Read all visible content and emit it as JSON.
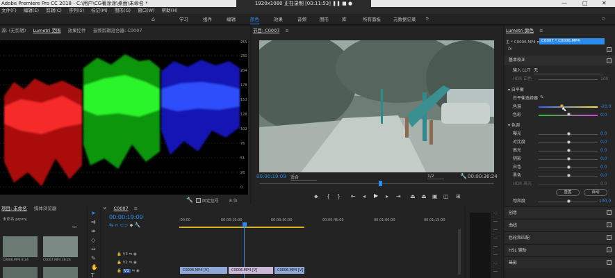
{
  "window": {
    "title": "Adobe Premiere Pro CC 2018 - C:\\用户\\CG著涂涂\\桌面\\未命名 *",
    "minimize": "—",
    "maximize": "□",
    "close": "✕"
  },
  "recorder": {
    "text": "1920x1080 正在录制 [00:11:53]"
  },
  "menu": {
    "items": [
      "文件(F)",
      "编辑(E)",
      "剪辑(C)",
      "序列(S)",
      "标记(M)",
      "图形(G)",
      "窗口(W)",
      "帮助(H)"
    ]
  },
  "workspaces": {
    "tabs": [
      "学习",
      "组件",
      "编辑",
      "颜色",
      "效果",
      "音频",
      "图形",
      "库",
      "所有面板",
      "元数据记录"
    ],
    "active": "颜色"
  },
  "scopes": {
    "tabs": [
      "源: (无剪辑)",
      "Lumetri 范围",
      "效果控件",
      "音频剪辑混合器: C0007"
    ],
    "y_left": [
      "100",
      "90",
      "80",
      "70",
      "60",
      "50",
      "40",
      "30",
      "20",
      "10",
      "0"
    ],
    "y_right": [
      "255",
      "230",
      "204",
      "178",
      "153",
      "128",
      "102",
      "76",
      "51",
      "26",
      "0"
    ],
    "clamp_label": "固定信号",
    "clamp_value": "8 位"
  },
  "program": {
    "title": "节目: C0007",
    "timecode": "00:00:19:09",
    "fit": "适合",
    "resolution": "1/2",
    "duration": "00:00:36:24"
  },
  "lumetri": {
    "title": "Lumetri 颜色",
    "master": "主 * C0006.MP4",
    "clip": "C0007 * C0006.MP4",
    "fx": "fx",
    "section_basic": "基本校正",
    "input_lut_label": "输入 LUT",
    "input_lut_value": "无",
    "hdr_label": "HDR 白色",
    "hdr_value": "100",
    "wb_header": "白平衡",
    "wb_picker": "白平衡选择器",
    "temperature_label": "色温",
    "temperature_value": "-20.0",
    "tint_label": "色彩",
    "tint_value": "0.0",
    "tone_header": "色调",
    "tone_rows": [
      {
        "label": "曝光",
        "value": "0.0"
      },
      {
        "label": "对比度",
        "value": "0.0"
      },
      {
        "label": "高光",
        "value": "0.0"
      },
      {
        "label": "阴影",
        "value": "0.0"
      },
      {
        "label": "白色",
        "value": "0.0"
      },
      {
        "label": "黑色",
        "value": "0.0"
      },
      {
        "label": "HDR 高光",
        "value": "0.0"
      }
    ],
    "reset_button": "重置",
    "auto_button": "自动",
    "saturation_label": "饱和度",
    "saturation_value": "100.0",
    "sections": [
      "创意",
      "曲线",
      "色轮和匹配",
      "HSL 辅助",
      "晕影"
    ]
  },
  "project": {
    "tabs": [
      "项目: 未命名",
      "媒体浏览器"
    ],
    "file": "未命名.prproj",
    "thumbs": [
      {
        "name": "C0006.MP4",
        "dur": "8:24"
      },
      {
        "name": "C0007.MP4",
        "dur": "36:24"
      }
    ]
  },
  "timeline": {
    "title": "C0007",
    "timecode": "00:00:19:09",
    "ruler": [
      ":00:00",
      "00:00:15:00",
      "00:00:30:00",
      "00:00:45:00",
      "00:01:00:00",
      "00:01:15:00"
    ],
    "tracks": [
      "V3",
      "V2",
      "V1"
    ],
    "clips": [
      "C0006.MP4 [V]",
      "C0006.MP4 [V]",
      "C0006.MP4 [V]"
    ]
  },
  "colors": {
    "accent": "#2d8ceb",
    "red": "#ff2020",
    "green": "#20ff20",
    "blue": "#2040ff"
  }
}
